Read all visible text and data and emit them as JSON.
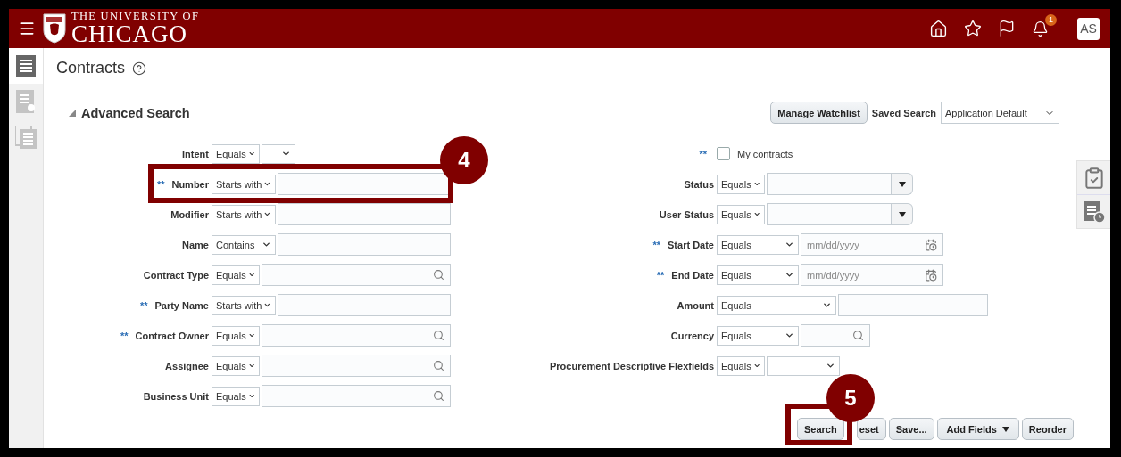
{
  "header": {
    "logo_top": "THE UNIVERSITY OF",
    "logo_bottom": "CHICAGO",
    "notification_count": "1",
    "avatar": "AS"
  },
  "sidebar": {
    "items": [
      {
        "selected": true
      },
      {
        "selected": false
      },
      {
        "selected": false
      }
    ]
  },
  "page": {
    "title": "Contracts"
  },
  "search": {
    "title": "Advanced Search",
    "expanded": true,
    "manage_button": "Manage Watchlist",
    "saved_search_label": "Saved Search",
    "saved_search_value": "Application Default"
  },
  "left_fields": [
    {
      "label": "Intent",
      "required": false,
      "operator": "Equals",
      "kind": "select"
    },
    {
      "label": "Number",
      "required": true,
      "operator": "Starts with",
      "kind": "text"
    },
    {
      "label": "Modifier",
      "required": false,
      "operator": "Starts with",
      "kind": "text"
    },
    {
      "label": "Name",
      "required": false,
      "operator": "Contains",
      "kind": "text"
    },
    {
      "label": "Contract Type",
      "required": false,
      "operator": "Equals",
      "kind": "lookup"
    },
    {
      "label": "Party Name",
      "required": true,
      "operator": "Starts with",
      "kind": "text"
    },
    {
      "label": "Contract Owner",
      "required": true,
      "operator": "Equals",
      "kind": "lookup"
    },
    {
      "label": "Assignee",
      "required": false,
      "operator": "Equals",
      "kind": "lookup"
    },
    {
      "label": "Business Unit",
      "required": false,
      "operator": "Equals",
      "kind": "lookup"
    }
  ],
  "right_fields": [
    {
      "label": "My contracts",
      "required": true,
      "kind": "checkbox",
      "checked": false
    },
    {
      "label": "Status",
      "required": false,
      "operator": "Equals",
      "kind": "choice"
    },
    {
      "label": "User Status",
      "required": false,
      "operator": "Equals",
      "kind": "choice"
    },
    {
      "label": "Start Date",
      "required": true,
      "operator": "Equals",
      "kind": "date",
      "placeholder": "mm/dd/yyyy"
    },
    {
      "label": "End Date",
      "required": true,
      "operator": "Equals",
      "kind": "date",
      "placeholder": "mm/dd/yyyy"
    },
    {
      "label": "Amount",
      "required": false,
      "operator": "Equals",
      "kind": "text"
    },
    {
      "label": "Currency",
      "required": false,
      "operator": "Equals",
      "kind": "lookup"
    },
    {
      "label": "Procurement Descriptive Flexfields",
      "required": false,
      "operator": "Equals",
      "kind": "select"
    }
  ],
  "required_mark": "**",
  "buttons": [
    "Search",
    "eset",
    "Save...",
    "Add Fields",
    "Reorder"
  ],
  "callouts": [
    {
      "label": "4"
    },
    {
      "label": "5"
    }
  ]
}
